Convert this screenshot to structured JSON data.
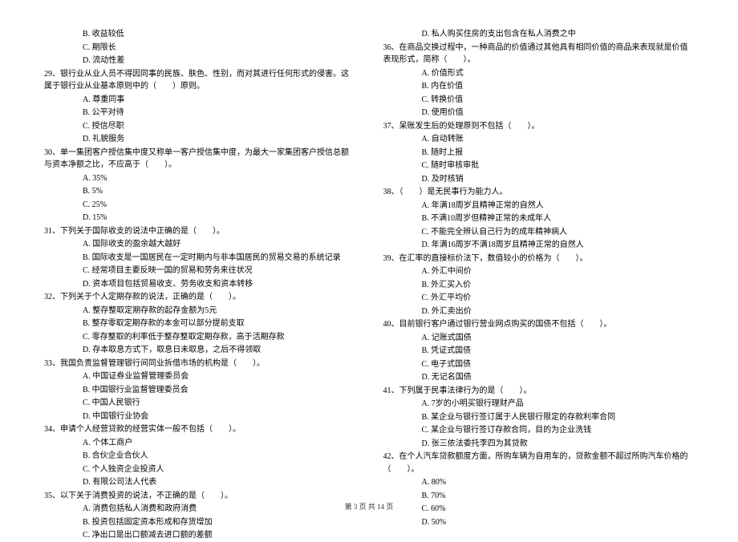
{
  "left": {
    "pre_opts": [
      "B. 收益较低",
      "C. 期限长",
      "D. 流动性差"
    ],
    "q29": "29、银行业从业人员不得因同事的民族、肤色、性别，而对其进行任何形式的侵害。这属于银行业从业基本原则中的（　　）原则。",
    "q29_opts": [
      "A. 尊重同事",
      "B. 公平对待",
      "C. 授信尽职",
      "D. 礼貌服务"
    ],
    "q30": "30、单一集团客户授信集中度又称单一客户授信集中度，为最大一家集团客户授信总额与资本净额之比，不应高于（　　）。",
    "q30_opts": [
      "A. 35%",
      "B. 5%",
      "C. 25%",
      "D. 15%"
    ],
    "q31": "31、下列关于国际收支的说法中正确的是（　　）。",
    "q31_opts": [
      "A. 国际收支的盈余越大越好",
      "B. 国际收支是一国居民在一定时期内与非本国居民的贸易交易的系统记录",
      "C. 经常项目主要反映一国的贸易和劳务来往状况",
      "D. 资本项目包括贸易收支、劳务收支和资本转移"
    ],
    "q32": "32、下列关于个人定期存款的说法，正确的是（　　）。",
    "q32_opts": [
      "A. 整存整取定期存款的起存金额为5元",
      "B. 整存零取定期存款的本金可以部分提前支取",
      "C. 零存整取的利率低于整存整取定期存款，高于活期存款",
      "D. 存本取息方式下，取息日未取息，之后不得领取"
    ],
    "q33": "33、我国负责监督管理银行间同业拆借市场的机构是（　　）。",
    "q33_opts": [
      "A. 中国证券业监督管理委员会",
      "B. 中国银行业监督管理委员会",
      "C. 中国人民银行",
      "D. 中国银行业协会"
    ],
    "q34": "34、申请个人经营贷款的经营实体一般不包括（　　）。",
    "q34_opts": [
      "A. 个体工商户",
      "B. 合伙企业合伙人",
      "C. 个人独资企业投资人",
      "D. 有限公司法人代表"
    ],
    "q35": "35、以下关于消费投资的说法，不正确的是（　　）。",
    "q35_opts": [
      "A. 消费包括私人消费和政府消费",
      "B. 投资包括固定资本形成和存货增加",
      "C. 净出口是出口额减去进口额的差额"
    ]
  },
  "right": {
    "pre_opts": [
      "D. 私人购买住房的支出包含在私人消费之中"
    ],
    "q36": "36、在商品交换过程中，一种商品的价值通过其他具有相同价值的商品来表现就是价值表现形式，简称（　　）。",
    "q36_opts": [
      "A. 价值形式",
      "B. 内在价值",
      "C. 转换价值",
      "D. 使用价值"
    ],
    "q37": "37、呆账发生后的处理原则不包括（　　）。",
    "q37_opts": [
      "A. 自动转账",
      "B. 随时上报",
      "C. 随时审核审批",
      "D. 及时核销"
    ],
    "q38": "38、（　　）是无民事行为能力人。",
    "q38_opts": [
      "A. 年满18周岁且精神正常的自然人",
      "B. 不满10周岁但精神正常的未成年人",
      "C. 不能完全辨认自己行为的成年精神病人",
      "D. 年满16周岁不满18周岁且精神正常的自然人"
    ],
    "q39": "39、在汇率的直接标价法下，数值较小的价格为（　　）。",
    "q39_opts": [
      "A. 外汇中间价",
      "B. 外汇买入价",
      "C. 外汇平均价",
      "D. 外汇卖出价"
    ],
    "q40": "40、目前银行客户通过银行营业网点购买的国债不包括（　　）。",
    "q40_opts": [
      "A. 记账式国债",
      "B. 凭证式国债",
      "C. 电子式国债",
      "D. 无记名国债"
    ],
    "q41": "41、下列属于民事法律行为的是（　　）。",
    "q41_opts": [
      "A. 7岁的小明买银行理财产品",
      "B. 某企业与银行签订属于人民银行限定的存款利率合同",
      "C. 某企业与银行签订存款合同，目的为企业洗钱",
      "D. 张三依法委托李四为其贷款"
    ],
    "q42": "42、在个人汽车贷款额度方面，所购车辆为自用车的，贷款金额不超过所购汽车价格的（　　）。",
    "q42_opts": [
      "A. 80%",
      "B. 70%",
      "C. 60%",
      "D. 50%"
    ]
  },
  "footer": "第 3 页 共 14 页"
}
